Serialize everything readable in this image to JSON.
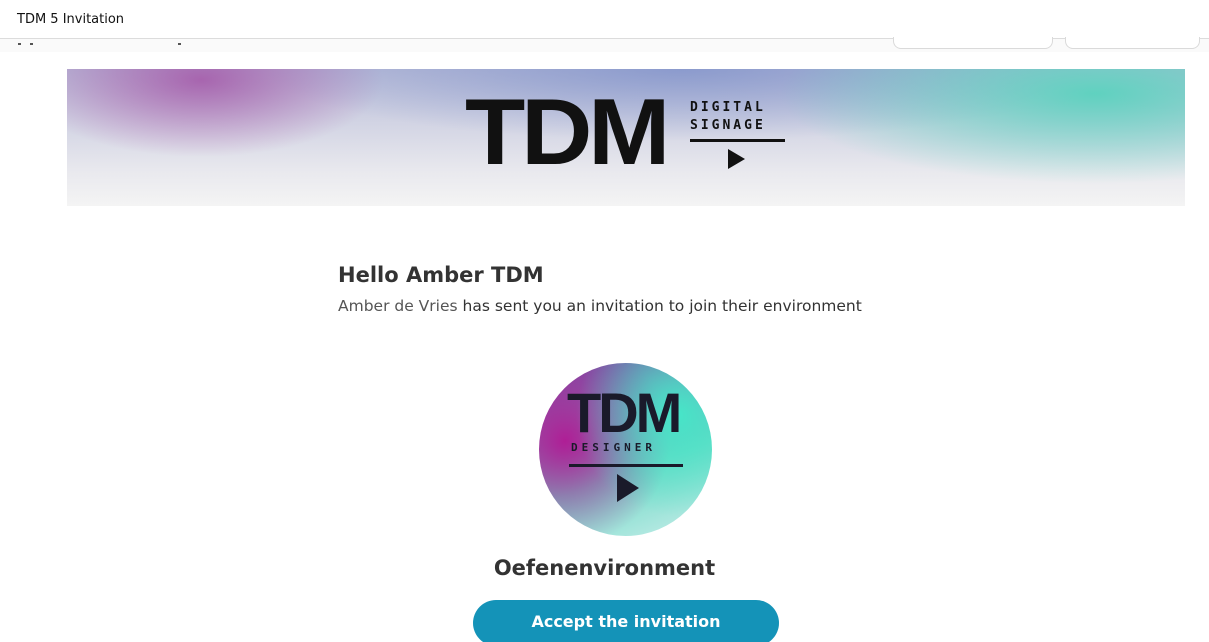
{
  "window": {
    "title": "TDM 5 Invitation"
  },
  "banner": {
    "brand_main": "TDM",
    "brand_line1": "DIGITAL",
    "brand_line2": "SIGNAGE"
  },
  "email": {
    "greeting": "Hello Amber TDM",
    "sender": "Amber de Vries",
    "message_rest": " has sent you an invitation to join their environment"
  },
  "environment": {
    "logo_main": "TDM",
    "logo_sub": "DESIGNER",
    "name": "Oefenenvironment"
  },
  "actions": {
    "accept_label": "Accept the invitation"
  },
  "colors": {
    "accent": "#1493b8",
    "text": "#333333"
  }
}
